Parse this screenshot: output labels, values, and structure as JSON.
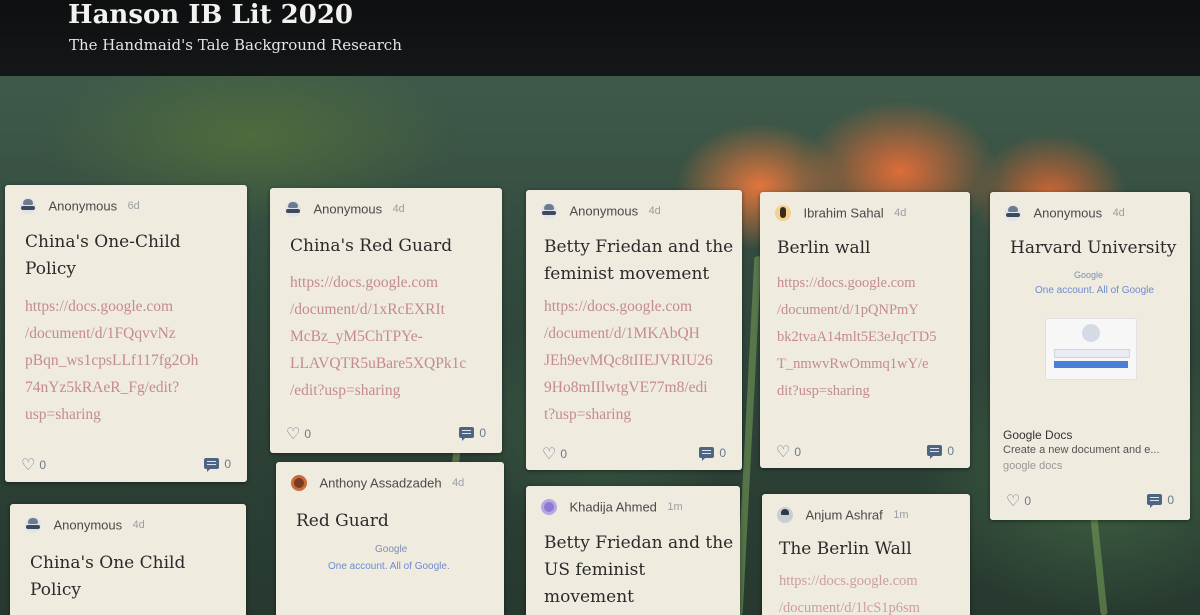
{
  "board": {
    "title": "Hanson IB Lit 2020",
    "subtitle": "The Handmaid's Tale Background Research"
  },
  "posts": [
    {
      "author": "Anonymous",
      "age": "6d",
      "title_lines": [
        "China's One-Child",
        "Policy"
      ],
      "link_lines": [
        "https://docs.google.com",
        "/document/d/1FQqvvNz",
        "pBqn_ws1cpsLLf117fg2Oh",
        "74nYz5kRAeR_Fg/edit?",
        "usp=sharing"
      ],
      "likes": "0",
      "comments": "0",
      "avatar": "anonymous-avatar"
    },
    {
      "author": "Anonymous",
      "age": "4d",
      "title_lines": [
        "China's One Child",
        "Policy"
      ],
      "avatar": "anonymous-avatar"
    },
    {
      "author": "Anonymous",
      "age": "4d",
      "title_lines": [
        "China's Red Guard"
      ],
      "link_lines": [
        "https://docs.google.com",
        "/document/d/1xRcEXRIt",
        "McBz_yM5ChTPYe-",
        "LLAVQTR5uBare5XQPk1c",
        "/edit?usp=sharing"
      ],
      "likes": "0",
      "comments": "0",
      "avatar": "anonymous-avatar"
    },
    {
      "author": "Anthony Assadzadeh",
      "age": "4d",
      "title_lines": [
        "Red Guard"
      ],
      "preview_logo": "Google",
      "preview_tagline": "One account. All of Google.",
      "avatar": "user-avatar"
    },
    {
      "author": "Anonymous",
      "age": "4d",
      "title_lines": [
        "Betty Friedan and the",
        "feminist movement"
      ],
      "link_lines": [
        "https://docs.google.com",
        "/document/d/1MKAbQH",
        "JEh9evMQc8tIIEJVRIU26",
        "9Ho8mIIlwtgVE77m8/edi",
        "t?usp=sharing"
      ],
      "likes": "0",
      "comments": "0",
      "avatar": "anonymous-avatar"
    },
    {
      "author": "Khadija Ahmed",
      "age": "1m",
      "title_lines": [
        "Betty Friedan and the",
        "US feminist",
        "movement"
      ],
      "avatar": "user-avatar"
    },
    {
      "author": "Ibrahim Sahal",
      "age": "4d",
      "title_lines": [
        "Berlin wall"
      ],
      "link_lines": [
        "https://docs.google.com",
        "/document/d/1pQNPmY",
        "bk2tvaA14mlt5E3eJqcTD5",
        "T_nmwvRwOmmq1wY/e",
        "dit?usp=sharing"
      ],
      "likes": "0",
      "comments": "0",
      "avatar": "user-avatar"
    },
    {
      "author": "Anjum Ashraf",
      "age": "1m",
      "title_lines": [
        "The Berlin Wall"
      ],
      "link_lines": [
        "https://docs.google.com",
        "/document/d/1lcS1p6sm"
      ],
      "avatar": "user-avatar"
    },
    {
      "author": "Anonymous",
      "age": "4d",
      "title_lines": [
        "Harvard University"
      ],
      "preview_logo": "Google",
      "preview_tagline": "One account. All of Google",
      "link_preview": {
        "title": "Google Docs",
        "desc": "Create a new document and e...",
        "site": "google docs"
      },
      "likes": "0",
      "comments": "0",
      "avatar": "anonymous-avatar"
    }
  ]
}
